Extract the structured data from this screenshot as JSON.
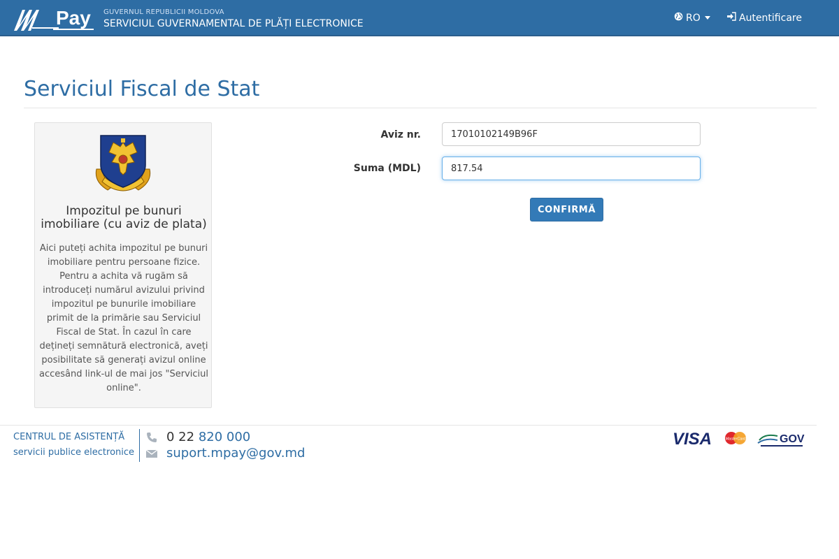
{
  "header": {
    "logo_text": "Pay",
    "gov_name": "GUVERNUL REPUBLICII MOLDOVA",
    "service_name": "SERVICIUL GUVERNAMENTAL DE PLĂȚI ELECTRONICE",
    "language": "RO",
    "login_label": "Autentificare"
  },
  "page": {
    "title": "Serviciul Fiscal de Stat"
  },
  "panel": {
    "title": "Impozitul pe bunuri imobiliare (cu aviz de plata)",
    "description": "Aici puteți achita impozitul pe bunuri imobiliare pentru persoane fizice. Pentru a achita vă rugăm să introduceți numărul avizului privind impozitul pe bunurile imobiliare primit de la primărie sau Serviciul Fiscal de Stat. În cazul în care dețineți semnătură electronică, aveți posibilitate să generați avizul online accesând link-ul de mai jos \"Serviciul online\".",
    "emblem_icon": "state-fiscal-service-emblem-icon"
  },
  "form": {
    "aviz_label": "Aviz nr.",
    "aviz_value": "17010102149B96F",
    "suma_label": "Suma (MDL)",
    "suma_value": "817.54",
    "confirm_label": "CONFIRMĂ"
  },
  "footer": {
    "help_line1": "CENTRUL DE ASISTENȚĂ",
    "help_line2": "servicii publice electronice",
    "phone_prefix": "0 22",
    "phone_number": "820 000",
    "email": "suport.mpay@gov.md",
    "visa": "VISA",
    "mastercard": "MasterCard",
    "gov": "GOV"
  },
  "colors": {
    "header_bg": "#2e6da4",
    "accent": "#337ab7",
    "panel_bg": "#f5f5f5"
  }
}
